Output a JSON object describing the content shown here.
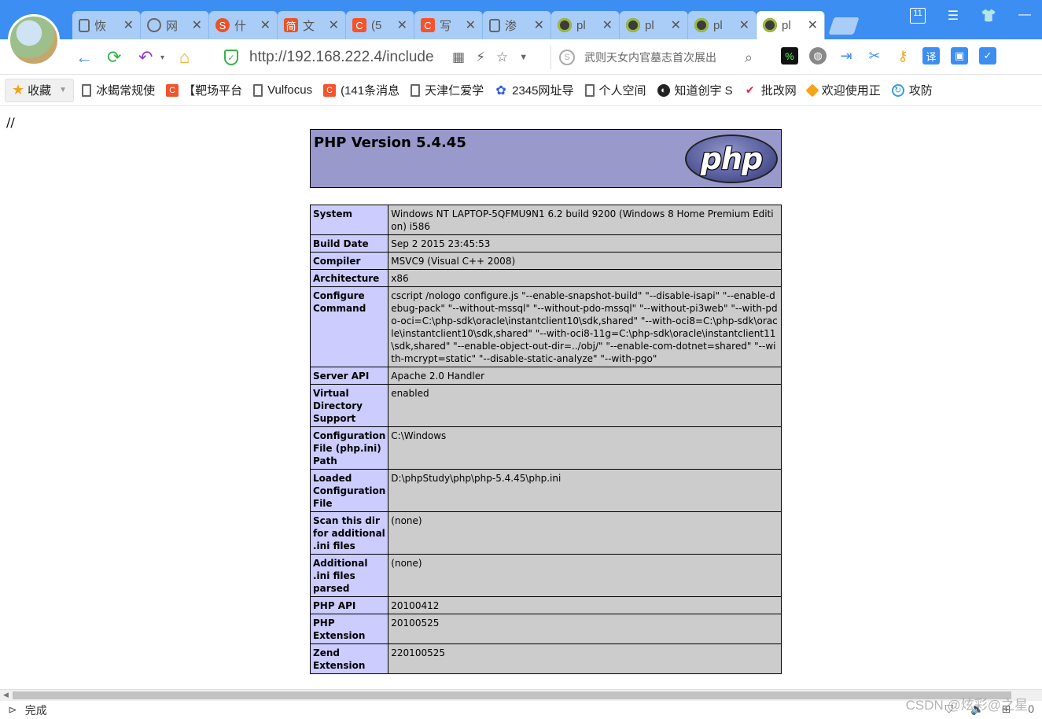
{
  "browser": {
    "tabs": [
      {
        "label": "恢",
        "icon": "document-icon"
      },
      {
        "label": "网",
        "icon": "globe-icon"
      },
      {
        "label": "什",
        "icon": "sogou-icon"
      },
      {
        "label": "文",
        "icon": "jianshu-icon"
      },
      {
        "label": "(5",
        "icon": "csdn-icon"
      },
      {
        "label": "写",
        "icon": "csdn-icon"
      },
      {
        "label": "渗",
        "icon": "document-icon"
      },
      {
        "label": "pl",
        "icon": "eclipse-icon"
      },
      {
        "label": "pl",
        "icon": "eclipse-icon"
      },
      {
        "label": "pl",
        "icon": "eclipse-icon"
      },
      {
        "label": "pl",
        "icon": "eclipse-icon"
      }
    ],
    "close_glyph": "✕",
    "tab_count_badge": "11",
    "url": "http://192.168.222.4/include",
    "search_hint": "武则天女内官墓志首次展出",
    "bookmarks_label": "收藏",
    "bookmarks": [
      {
        "label": "冰蝎常规使",
        "icon": "document-icon"
      },
      {
        "label": "【靶场平台",
        "icon": "csdn-icon"
      },
      {
        "label": "Vulfocus",
        "icon": "document-icon"
      },
      {
        "label": "(141条消息",
        "icon": "csdn-icon"
      },
      {
        "label": "天津仁爱学",
        "icon": "document-icon"
      },
      {
        "label": "2345网址导",
        "icon": "paw-icon"
      },
      {
        "label": "个人空间",
        "icon": "document-icon"
      },
      {
        "label": "知道创宇 S",
        "icon": "knownsec-icon"
      },
      {
        "label": "批改网",
        "icon": "check-icon"
      },
      {
        "label": "欢迎使用正",
        "icon": "cube-icon"
      },
      {
        "label": "攻防",
        "icon": "attack-icon"
      }
    ],
    "status_text": "完成",
    "status_right": [
      "0"
    ],
    "watermark": "CSDN @炫彩@之星"
  },
  "page": {
    "prefix_text": "//",
    "php_title": "PHP Version 5.4.45",
    "php_logo_text": "php",
    "rows": [
      {
        "key": "System",
        "value": "Windows NT LAPTOP-5QFMU9N1 6.2 build 9200 (Windows 8 Home Premium Edition) i586"
      },
      {
        "key": "Build Date",
        "value": "Sep 2 2015 23:45:53"
      },
      {
        "key": "Compiler",
        "value": "MSVC9 (Visual C++ 2008)"
      },
      {
        "key": "Architecture",
        "value": "x86"
      },
      {
        "key": "Configure Command",
        "value": "cscript /nologo configure.js \"--enable-snapshot-build\" \"--disable-isapi\" \"--enable-debug-pack\" \"--without-mssql\" \"--without-pdo-mssql\" \"--without-pi3web\" \"--with-pdo-oci=C:\\php-sdk\\oracle\\instantclient10\\sdk,shared\" \"--with-oci8=C:\\php-sdk\\oracle\\instantclient10\\sdk,shared\" \"--with-oci8-11g=C:\\php-sdk\\oracle\\instantclient11\\sdk,shared\" \"--enable-object-out-dir=../obj/\" \"--enable-com-dotnet=shared\" \"--with-mcrypt=static\" \"--disable-static-analyze\" \"--with-pgo\""
      },
      {
        "key": "Server API",
        "value": "Apache 2.0 Handler"
      },
      {
        "key": "Virtual Directory Support",
        "value": "enabled"
      },
      {
        "key": "Configuration File (php.ini) Path",
        "value": "C:\\Windows"
      },
      {
        "key": "Loaded Configuration File",
        "value": "D:\\phpStudy\\php\\php-5.4.45\\php.ini"
      },
      {
        "key": "Scan this dir for additional .ini files",
        "value": "(none)"
      },
      {
        "key": "Additional .ini files parsed",
        "value": "(none)"
      },
      {
        "key": "PHP API",
        "value": "20100412"
      },
      {
        "key": "PHP Extension",
        "value": "20100525"
      },
      {
        "key": "Zend Extension",
        "value": "220100525"
      }
    ]
  }
}
